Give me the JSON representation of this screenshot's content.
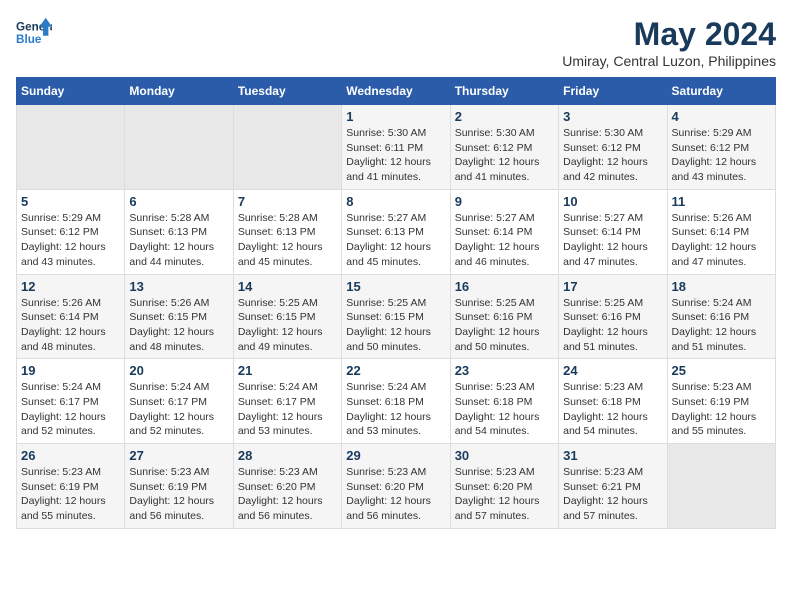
{
  "logo": {
    "line1": "General",
    "line2": "Blue"
  },
  "title": "May 2024",
  "subtitle": "Umiray, Central Luzon, Philippines",
  "weekdays": [
    "Sunday",
    "Monday",
    "Tuesday",
    "Wednesday",
    "Thursday",
    "Friday",
    "Saturday"
  ],
  "weeks": [
    [
      {
        "day": "",
        "info": ""
      },
      {
        "day": "",
        "info": ""
      },
      {
        "day": "",
        "info": ""
      },
      {
        "day": "1",
        "info": "Sunrise: 5:30 AM\nSunset: 6:11 PM\nDaylight: 12 hours\nand 41 minutes."
      },
      {
        "day": "2",
        "info": "Sunrise: 5:30 AM\nSunset: 6:12 PM\nDaylight: 12 hours\nand 41 minutes."
      },
      {
        "day": "3",
        "info": "Sunrise: 5:30 AM\nSunset: 6:12 PM\nDaylight: 12 hours\nand 42 minutes."
      },
      {
        "day": "4",
        "info": "Sunrise: 5:29 AM\nSunset: 6:12 PM\nDaylight: 12 hours\nand 43 minutes."
      }
    ],
    [
      {
        "day": "5",
        "info": "Sunrise: 5:29 AM\nSunset: 6:12 PM\nDaylight: 12 hours\nand 43 minutes."
      },
      {
        "day": "6",
        "info": "Sunrise: 5:28 AM\nSunset: 6:13 PM\nDaylight: 12 hours\nand 44 minutes."
      },
      {
        "day": "7",
        "info": "Sunrise: 5:28 AM\nSunset: 6:13 PM\nDaylight: 12 hours\nand 45 minutes."
      },
      {
        "day": "8",
        "info": "Sunrise: 5:27 AM\nSunset: 6:13 PM\nDaylight: 12 hours\nand 45 minutes."
      },
      {
        "day": "9",
        "info": "Sunrise: 5:27 AM\nSunset: 6:14 PM\nDaylight: 12 hours\nand 46 minutes."
      },
      {
        "day": "10",
        "info": "Sunrise: 5:27 AM\nSunset: 6:14 PM\nDaylight: 12 hours\nand 47 minutes."
      },
      {
        "day": "11",
        "info": "Sunrise: 5:26 AM\nSunset: 6:14 PM\nDaylight: 12 hours\nand 47 minutes."
      }
    ],
    [
      {
        "day": "12",
        "info": "Sunrise: 5:26 AM\nSunset: 6:14 PM\nDaylight: 12 hours\nand 48 minutes."
      },
      {
        "day": "13",
        "info": "Sunrise: 5:26 AM\nSunset: 6:15 PM\nDaylight: 12 hours\nand 48 minutes."
      },
      {
        "day": "14",
        "info": "Sunrise: 5:25 AM\nSunset: 6:15 PM\nDaylight: 12 hours\nand 49 minutes."
      },
      {
        "day": "15",
        "info": "Sunrise: 5:25 AM\nSunset: 6:15 PM\nDaylight: 12 hours\nand 50 minutes."
      },
      {
        "day": "16",
        "info": "Sunrise: 5:25 AM\nSunset: 6:16 PM\nDaylight: 12 hours\nand 50 minutes."
      },
      {
        "day": "17",
        "info": "Sunrise: 5:25 AM\nSunset: 6:16 PM\nDaylight: 12 hours\nand 51 minutes."
      },
      {
        "day": "18",
        "info": "Sunrise: 5:24 AM\nSunset: 6:16 PM\nDaylight: 12 hours\nand 51 minutes."
      }
    ],
    [
      {
        "day": "19",
        "info": "Sunrise: 5:24 AM\nSunset: 6:17 PM\nDaylight: 12 hours\nand 52 minutes."
      },
      {
        "day": "20",
        "info": "Sunrise: 5:24 AM\nSunset: 6:17 PM\nDaylight: 12 hours\nand 52 minutes."
      },
      {
        "day": "21",
        "info": "Sunrise: 5:24 AM\nSunset: 6:17 PM\nDaylight: 12 hours\nand 53 minutes."
      },
      {
        "day": "22",
        "info": "Sunrise: 5:24 AM\nSunset: 6:18 PM\nDaylight: 12 hours\nand 53 minutes."
      },
      {
        "day": "23",
        "info": "Sunrise: 5:23 AM\nSunset: 6:18 PM\nDaylight: 12 hours\nand 54 minutes."
      },
      {
        "day": "24",
        "info": "Sunrise: 5:23 AM\nSunset: 6:18 PM\nDaylight: 12 hours\nand 54 minutes."
      },
      {
        "day": "25",
        "info": "Sunrise: 5:23 AM\nSunset: 6:19 PM\nDaylight: 12 hours\nand 55 minutes."
      }
    ],
    [
      {
        "day": "26",
        "info": "Sunrise: 5:23 AM\nSunset: 6:19 PM\nDaylight: 12 hours\nand 55 minutes."
      },
      {
        "day": "27",
        "info": "Sunrise: 5:23 AM\nSunset: 6:19 PM\nDaylight: 12 hours\nand 56 minutes."
      },
      {
        "day": "28",
        "info": "Sunrise: 5:23 AM\nSunset: 6:20 PM\nDaylight: 12 hours\nand 56 minutes."
      },
      {
        "day": "29",
        "info": "Sunrise: 5:23 AM\nSunset: 6:20 PM\nDaylight: 12 hours\nand 56 minutes."
      },
      {
        "day": "30",
        "info": "Sunrise: 5:23 AM\nSunset: 6:20 PM\nDaylight: 12 hours\nand 57 minutes."
      },
      {
        "day": "31",
        "info": "Sunrise: 5:23 AM\nSunset: 6:21 PM\nDaylight: 12 hours\nand 57 minutes."
      },
      {
        "day": "",
        "info": ""
      }
    ]
  ]
}
